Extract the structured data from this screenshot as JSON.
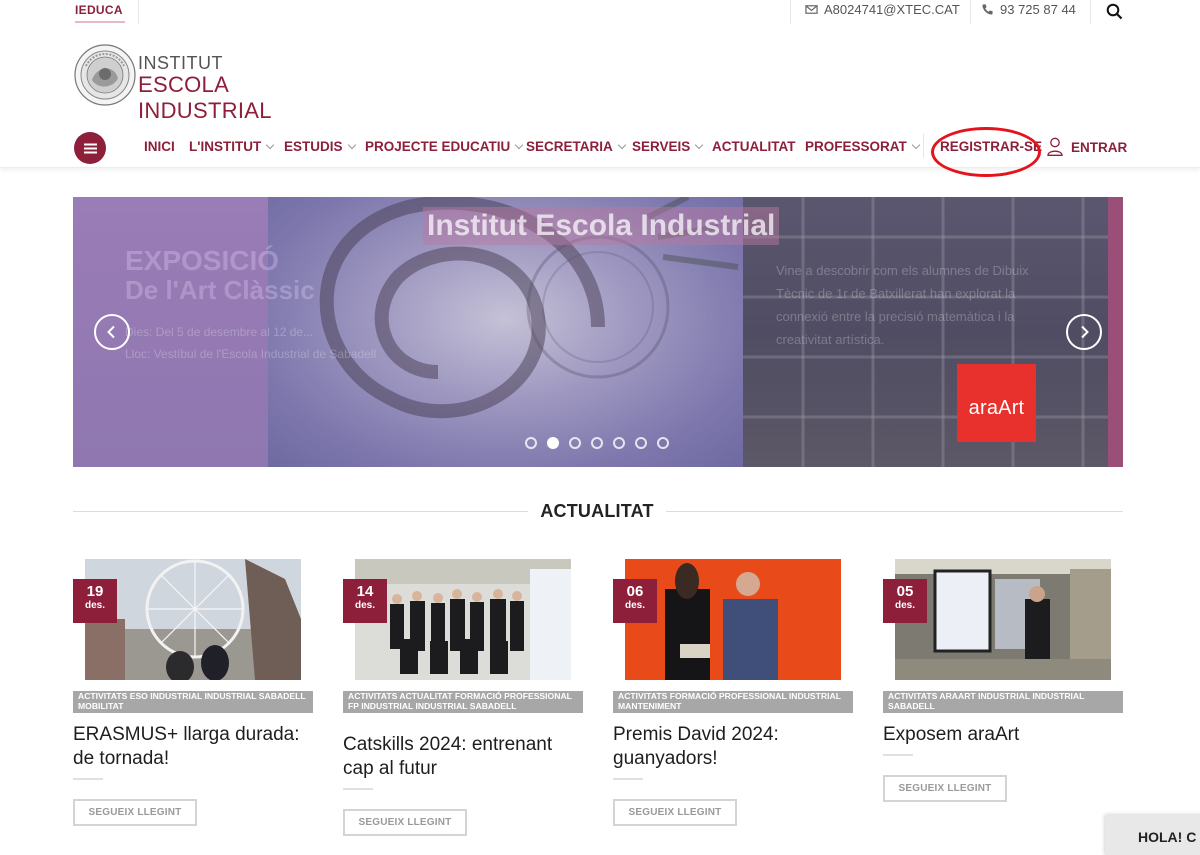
{
  "topbar": {
    "brand": "IEDUCA",
    "email": "A8024741@XTEC.CAT",
    "phone": "93 725 87 44"
  },
  "logo": {
    "line1": "INSTITUT",
    "line2": "ESCOLA INDUSTRIAL"
  },
  "nav": {
    "items": [
      {
        "label": "INICI"
      },
      {
        "label": "L'INSTITUT"
      },
      {
        "label": "ESTUDIS"
      },
      {
        "label": "PROJECTE EDUCATIU"
      },
      {
        "label": "SECRETARIA"
      },
      {
        "label": "SERVEIS"
      },
      {
        "label": "ACTUALITAT"
      },
      {
        "label": "PROFESSORAT"
      }
    ],
    "register": "REGISTRAR-SE",
    "login": "ENTRAR"
  },
  "slider": {
    "title": "Institut Escola Industrial",
    "ghost_heading_1": "EXPOSICIÓ",
    "ghost_heading_2": "De l'Art Clàssic",
    "ghost_line_1": "Dies: Del 5 de desembre al 12 de...",
    "ghost_line_2": "Lloc: Vestíbul de l'Escola Industrial de Sabadell",
    "ghost_text_right": "Vine a descobrir com els alumnes de Dibuix Tècnic de 1r de Batxillerat han explorat la connexió entre la precisió matemàtica i la creativitat artística.",
    "badge": "araArt",
    "dots_count": 7,
    "active_dot": 1
  },
  "section": {
    "title": "ACTUALITAT"
  },
  "posts": [
    {
      "day": "19",
      "month": "des.",
      "categories": "ACTIVITATS ESO INDUSTRIAL INDUSTRIAL SABADELL MOBILITAT",
      "title": "ERASMUS+ llarga durada: de tornada!",
      "cta": "SEGUEIX LLEGINT"
    },
    {
      "day": "14",
      "month": "des.",
      "categories": "ACTIVITATS ACTUALITAT FORMACIÓ PROFESSIONAL FP INDUSTRIAL INDUSTRIAL SABADELL",
      "title": "Catskills 2024: entrenant cap al futur",
      "cta": "SEGUEIX LLEGINT"
    },
    {
      "day": "06",
      "month": "des.",
      "categories": "ACTIVITATS FORMACIÓ PROFESSIONAL INDUSTRIAL MANTENIMENT",
      "title": "Premis David 2024: guanyadors!",
      "cta": "SEGUEIX LLEGINT"
    },
    {
      "day": "05",
      "month": "des.",
      "categories": "ACTIVITATS ARAART INDUSTRIAL INDUSTRIAL SABADELL",
      "title": "Exposem araArt",
      "cta": "SEGUEIX LLEGINT"
    }
  ],
  "chat": {
    "label": "HOLA! C"
  },
  "colors": {
    "brand": "#8d1f3b",
    "highlight_circle": "#e4141c"
  }
}
